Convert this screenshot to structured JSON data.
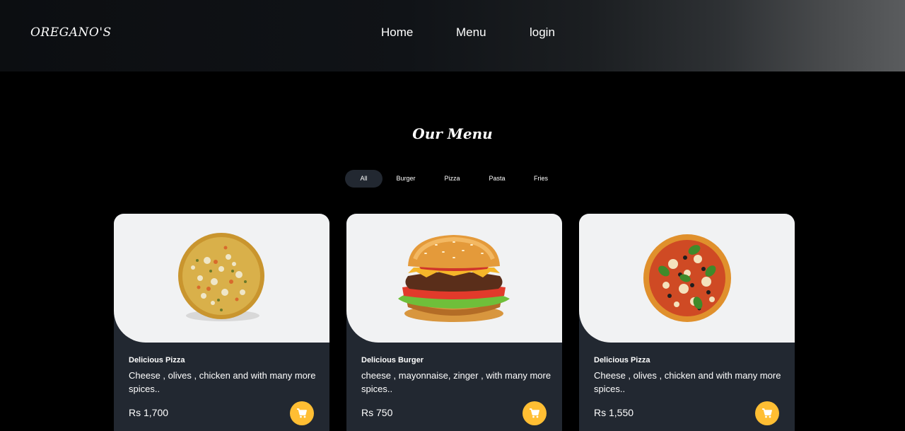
{
  "brand": {
    "logo": "OREGANO'S"
  },
  "nav": {
    "items": [
      "Home",
      "Menu",
      "login"
    ]
  },
  "menu": {
    "title": "Our Menu",
    "filters": [
      "All",
      "Burger",
      "Pizza",
      "Pasta",
      "Fries"
    ],
    "active_filter": "All"
  },
  "cards": [
    {
      "title": "Delicious Pizza",
      "description": "Cheese , olives , chicken and with many more spices..",
      "price": "Rs 1,700",
      "image_icon": "pizza-image"
    },
    {
      "title": "Delicious Burger",
      "description": "cheese , mayonnaise, zinger , with many more spices..",
      "price": "Rs 750",
      "image_icon": "burger-image"
    },
    {
      "title": "Delicious Pizza",
      "description": "Cheese , olives , chicken and with many more spices..",
      "price": "Rs 1,550",
      "image_icon": "pizza-image"
    }
  ],
  "colors": {
    "accent": "#ffbe33",
    "card_bg": "#222831",
    "image_bg": "#f1f2f3",
    "page_bg": "#000000"
  },
  "icons": {
    "cart": "cart-icon"
  }
}
